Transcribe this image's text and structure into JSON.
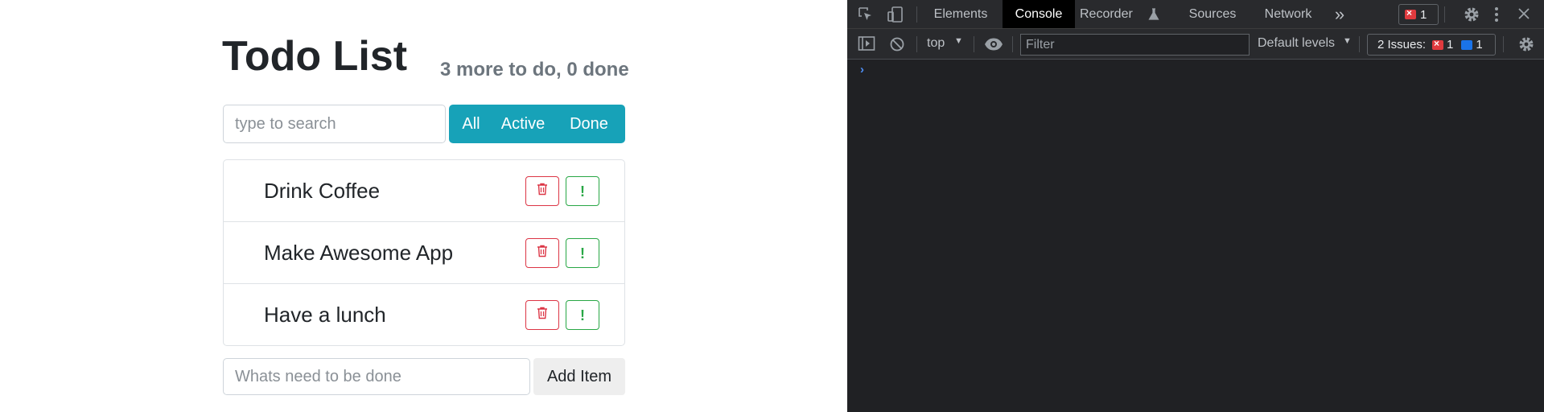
{
  "app": {
    "title": "Todo List",
    "summary": "3 more to do, 0 done",
    "search": {
      "placeholder": "type to search"
    },
    "filters": [
      {
        "label": "All"
      },
      {
        "label": "Active"
      },
      {
        "label": "Done"
      }
    ],
    "items": [
      {
        "label": "Drink Coffee"
      },
      {
        "label": "Make Awesome App"
      },
      {
        "label": "Have a lunch"
      }
    ],
    "item_buttons": {
      "delete_icon": "trash-icon",
      "important_icon": "exclamation-icon",
      "important_glyph": "!"
    },
    "add": {
      "placeholder": "Whats need to be done",
      "button_label": "Add Item"
    },
    "colors": {
      "filter_bg": "#17a2b8",
      "delete": "#dc3545",
      "important": "#28a745"
    }
  },
  "devtools": {
    "tabs": [
      {
        "label": "Elements"
      },
      {
        "label": "Console"
      },
      {
        "label": "Recorder"
      },
      {
        "label": "Sources"
      },
      {
        "label": "Network"
      }
    ],
    "more_tabs": "»",
    "error_count": "1",
    "context": "top",
    "filter_placeholder": "Filter",
    "levels": "Default levels",
    "issues_label": "2 Issues:",
    "issues_errors": "1",
    "issues_info": "1",
    "prompt": "›",
    "icons": [
      "inspect-icon",
      "device-toolbar-icon",
      "recorder-flask-icon",
      "settings-icon",
      "more-options-icon",
      "close-icon",
      "sidebar-toggle-icon",
      "clear-console-icon",
      "eye-icon",
      "console-settings-icon"
    ]
  }
}
